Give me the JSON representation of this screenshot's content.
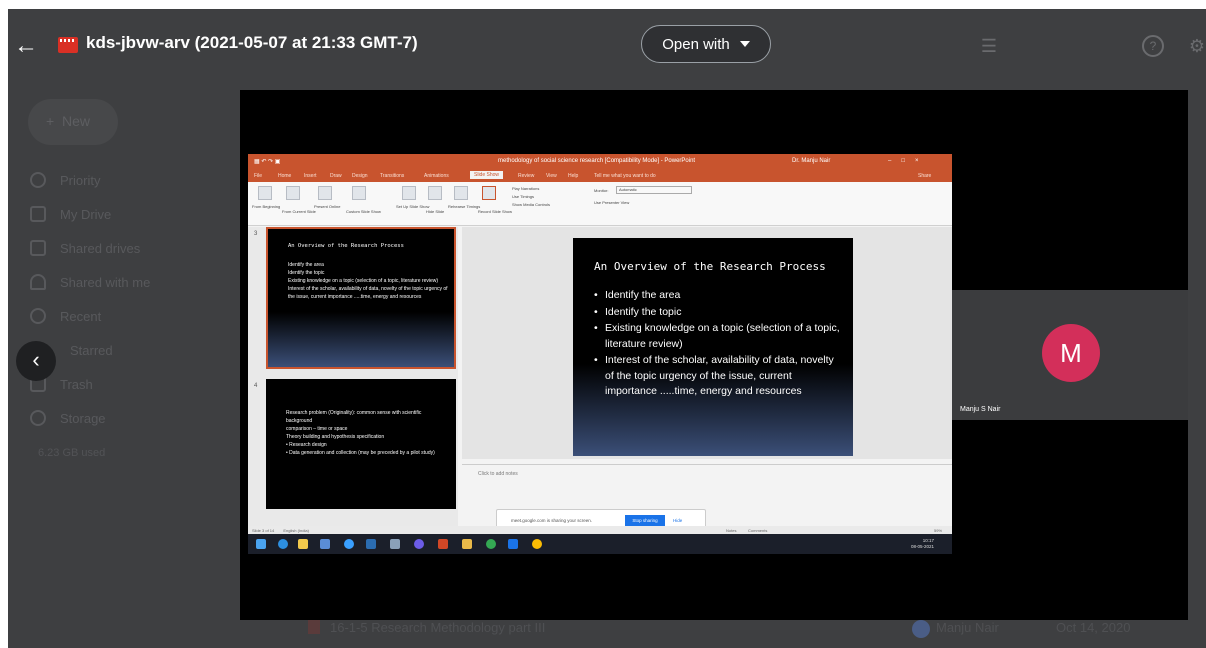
{
  "header": {
    "file_title": "kds-jbvw-arv (2021-05-07 at 21:33 GMT-7)",
    "open_with_label": "Open with"
  },
  "sidebar": {
    "new_label": "New",
    "items": [
      {
        "label": "Priority",
        "icon": "check-circle-icon"
      },
      {
        "label": "My Drive",
        "icon": "drive-icon"
      },
      {
        "label": "Shared drives",
        "icon": "shared-drives-icon"
      },
      {
        "label": "Shared with me",
        "icon": "people-icon"
      },
      {
        "label": "Recent",
        "icon": "clock-icon"
      },
      {
        "label": "Starred",
        "icon": "star-icon"
      },
      {
        "label": "Trash",
        "icon": "trash-icon"
      },
      {
        "label": "Storage",
        "icon": "cloud-icon"
      }
    ],
    "storage_text": "6.23 GB used"
  },
  "bottom_row": {
    "file_name": "16-1-5 Research Methodology part III",
    "owner": "Manju Nair",
    "modified": "Oct 14, 2020"
  },
  "video": {
    "ppt": {
      "window_title": "methodology of social science research [Compatibility Mode] - PowerPoint",
      "user": "Dr. Manju Nair",
      "menu": [
        "File",
        "Home",
        "Insert",
        "Draw",
        "Design",
        "Transitions",
        "Animations",
        "Slide Show",
        "Review",
        "View",
        "Help",
        "Tell me what you want to do",
        "Share"
      ],
      "active_tab": "Slide Show",
      "ribbon": [
        "From Beginning",
        "From Current Slide",
        "Present Online",
        "Custom Slide Show",
        "Set Up Slide Show",
        "Hide Slide",
        "Rehearse Timings",
        "Record Slide Show"
      ],
      "ribbon_options": [
        "Play Narrations",
        "Use Timings",
        "Show Media Controls"
      ],
      "monitor_label": "Monitor:",
      "monitor_value": "Automatic",
      "presenter_view": "Use Presenter View",
      "thumbnails": [
        {
          "num": "3",
          "title": "An Overview of the Research Process",
          "bullets": [
            "Identify the area",
            "Identify the topic",
            "Existing knowledge on a topic (selection of a topic, literature review)",
            "Interest of the scholar, availability of data, novelty of the topic urgency of the issue, current importance .....time, energy and resources"
          ]
        },
        {
          "num": "4",
          "lines": [
            "Research problem (Originality): common sense with scientific background",
            "comparison – time or space",
            "Theory building and hypothesis specification",
            "• Research design",
            "• Data generation and collection (may be preceded by a pilot study)"
          ]
        }
      ],
      "slide": {
        "title": "An Overview of the Research Process",
        "bullets": [
          "Identify the area",
          "Identify the topic",
          "Existing knowledge on a topic (selection of a topic, literature review)",
          "Interest of the scholar, availability of data, novelty of the topic urgency of the issue, current importance .....time, energy and resources"
        ]
      },
      "notes_placeholder": "Click to add notes",
      "share_message": "meet.google.com is sharing your screen.",
      "stop_sharing": "Stop sharing",
      "hide": "Hide",
      "status_left": "Slide 3 of 14",
      "status_lang": "English (India)",
      "status_notes": "Notes",
      "status_comments": "Comments",
      "zoom": "59%",
      "clock_time": "10:17",
      "clock_date": "08-05-2021"
    },
    "participant": {
      "initial": "M",
      "name": "Manju S Nair",
      "avatar_color": "#d32f5a"
    }
  }
}
